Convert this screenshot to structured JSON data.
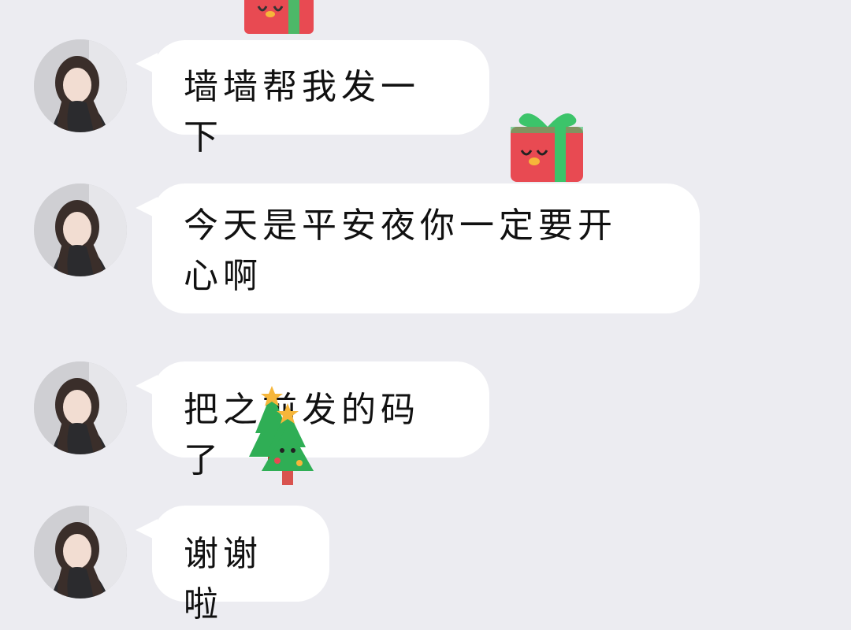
{
  "chat": {
    "messages": [
      {
        "text": "墙墙帮我发一下",
        "avatar": "girl-portrait-avatar"
      },
      {
        "text": "今天是平安夜你一定要开心啊",
        "avatar": "girl-portrait-avatar"
      },
      {
        "text": "把之前发的码了",
        "avatar": "girl-portrait-avatar"
      },
      {
        "text": "谢谢啦",
        "avatar": "girl-portrait-avatar"
      }
    ],
    "stickers": [
      {
        "name": "gift-box-sticker"
      },
      {
        "name": "christmas-tree-sticker"
      }
    ]
  },
  "colors": {
    "background": "#ececf1",
    "bubble": "#ffffff",
    "text": "#111111",
    "gift_red": "#e84a52",
    "gift_ribbon": "#3cc46a",
    "tree_green": "#2fae55",
    "tree_star": "#f6b63a"
  }
}
